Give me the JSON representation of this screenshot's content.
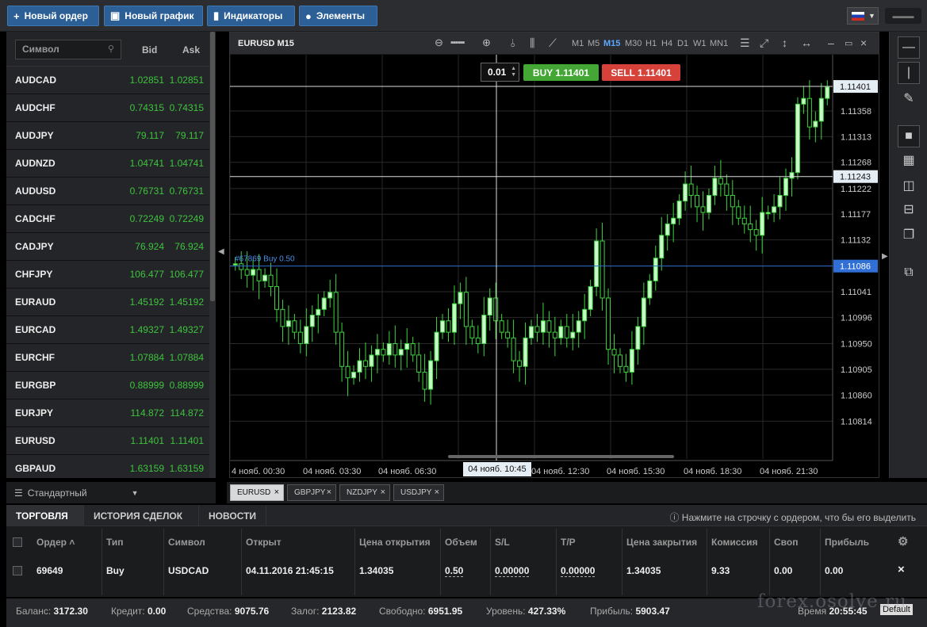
{
  "toolbar": {
    "new_order": "Новый ордер",
    "new_chart": "Новый график",
    "indicators": "Индикаторы",
    "elements": "Элементы",
    "avatar_text": "▬▬▬"
  },
  "market_watch": {
    "search_placeholder": "Символ",
    "col_bid": "Bid",
    "col_ask": "Ask",
    "rows": [
      {
        "symbol": "AUDCAD",
        "bid": "1.02851",
        "ask": "1.02851"
      },
      {
        "symbol": "AUDCHF",
        "bid": "0.74315",
        "ask": "0.74315"
      },
      {
        "symbol": "AUDJPY",
        "bid": "79.117",
        "ask": "79.117"
      },
      {
        "symbol": "AUDNZD",
        "bid": "1.04741",
        "ask": "1.04741"
      },
      {
        "symbol": "AUDUSD",
        "bid": "0.76731",
        "ask": "0.76731"
      },
      {
        "symbol": "CADCHF",
        "bid": "0.72249",
        "ask": "0.72249"
      },
      {
        "symbol": "CADJPY",
        "bid": "76.924",
        "ask": "76.924"
      },
      {
        "symbol": "CHFJPY",
        "bid": "106.477",
        "ask": "106.477"
      },
      {
        "symbol": "EURAUD",
        "bid": "1.45192",
        "ask": "1.45192"
      },
      {
        "symbol": "EURCAD",
        "bid": "1.49327",
        "ask": "1.49327"
      },
      {
        "symbol": "EURCHF",
        "bid": "1.07884",
        "ask": "1.07884"
      },
      {
        "symbol": "EURGBP",
        "bid": "0.88999",
        "ask": "0.88999"
      },
      {
        "symbol": "EURJPY",
        "bid": "114.872",
        "ask": "114.872"
      },
      {
        "symbol": "EURUSD",
        "bid": "1.11401",
        "ask": "1.11401"
      },
      {
        "symbol": "GBPAUD",
        "bid": "1.63159",
        "ask": "1.63159"
      }
    ],
    "profile": "Стандартный"
  },
  "chart": {
    "symbol_title": "EURUSD M15",
    "timeframes": [
      "M1",
      "M5",
      "M15",
      "M30",
      "H1",
      "H4",
      "D1",
      "W1",
      "MN1"
    ],
    "active_timeframe": "M15",
    "lot": "0.01",
    "buy_label": "BUY 1.11401",
    "sell_label": "SELL 1.11401",
    "order_label": "#67869 Buy 0.50",
    "price_ticks": [
      "1.11358",
      "1.11313",
      "1.11268",
      "1.11222",
      "1.11177",
      "1.11132",
      "1.11041",
      "1.10996",
      "1.10950",
      "1.10905",
      "1.10860",
      "1.10814"
    ],
    "price_markers": {
      "current": "1.11401",
      "crosshair": "1.11243",
      "order": "1.11086"
    },
    "time_ticks": [
      "4 нояб. 00:30",
      "04 нояб. 03:30",
      "04 нояб. 06:30",
      "04 нояб. 12:30",
      "04 нояб. 15:30",
      "04 нояб. 18:30",
      "04 нояб. 21:30"
    ],
    "crosshair_time": "04 нояб. 10:45",
    "colors": {
      "bull": "#3fd43f",
      "bear": "#3fd43f",
      "grid": "#2a2a2a",
      "order_line": "#2f6fd6"
    }
  },
  "chart_tabs": [
    "EURUSD",
    "GBPJPY",
    "NZDJPY",
    "USDJPY"
  ],
  "terminal": {
    "tabs": [
      "ТОРГОВЛЯ",
      "ИСТОРИЯ СДЕЛОК",
      "НОВОСТИ"
    ],
    "hint": "Нажмите на строчку с ордером, что бы его выделить",
    "columns": [
      "Ордер ˄",
      "Тип",
      "Символ",
      "Открыт",
      "Цена открытия",
      "Объем",
      "S/L",
      "T/P",
      "Цена закрытия",
      "Комиссия",
      "Своп",
      "Прибыль"
    ],
    "row": {
      "order": "69649",
      "type": "Buy",
      "symbol": "USDCAD",
      "opened": "04.11.2016 21:45:15",
      "open_price": "1.34035",
      "volume": "0.50",
      "sl": "0.00000",
      "tp": "0.00000",
      "close_price": "1.34035",
      "commission": "9.33",
      "swap": "0.00",
      "profit": "0.00"
    }
  },
  "status": {
    "balance_label": "Баланс:",
    "balance": "3172.30",
    "credit_label": "Кредит:",
    "credit": "0.00",
    "funds_label": "Средства:",
    "funds": "9075.76",
    "margin_label": "Залог:",
    "margin": "2123.82",
    "free_label": "Свободно:",
    "free": "6951.95",
    "level_label": "Уровень:",
    "level": "427.33%",
    "profit_label": "Прибыль:",
    "profit": "5903.47",
    "time_label": "Время",
    "time": "20:55:45",
    "default_label": "Default"
  },
  "watermark": "forex.osolve.ru"
}
